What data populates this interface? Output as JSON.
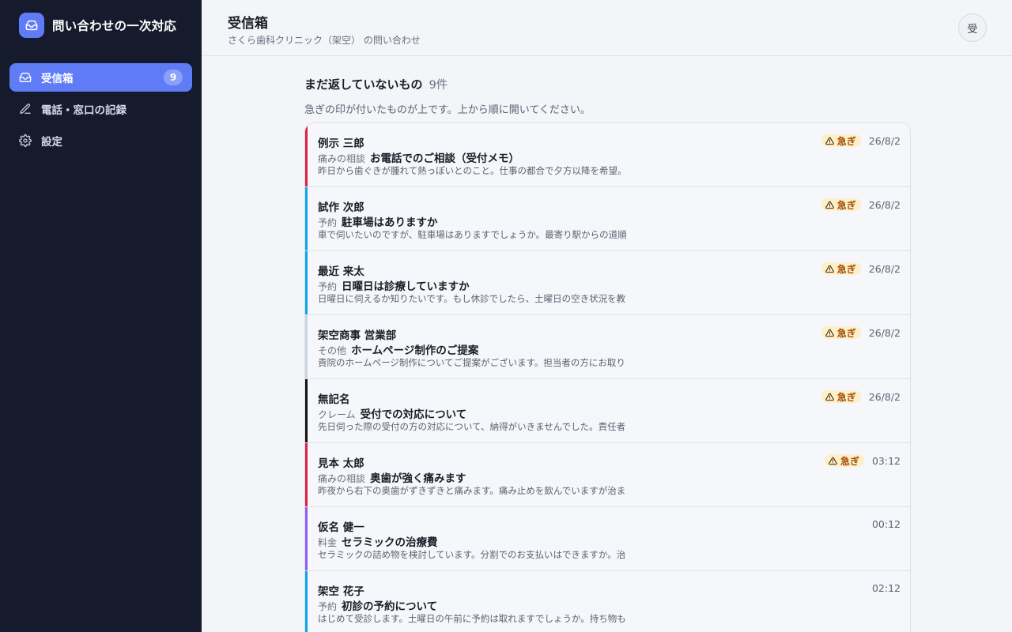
{
  "app": {
    "title": "問い合わせの一次対応"
  },
  "sidebar": {
    "items": [
      {
        "label": "受信箱",
        "badge": "9",
        "icon": "inbox-icon",
        "active": true
      },
      {
        "label": "電話・窓口の記録",
        "icon": "pencil-icon"
      },
      {
        "label": "設定",
        "icon": "gear-icon"
      }
    ]
  },
  "header": {
    "title": "受信箱",
    "subtitle": "さくら歯科クリニック（架空） の問い合わせ",
    "avatar": "受"
  },
  "main": {
    "section_title": "まだ返していないもの",
    "count": "9件",
    "note": "急ぎの印が付いたものが上です。上から順に開いてください。",
    "urgent_label": "急ぎ"
  },
  "colors": {
    "accent": "#5f7cf6",
    "sidebar_bg": "#151a2d",
    "urgent_bg": "#fdefc8",
    "urgent_text": "#a4510b"
  },
  "messages": [
    {
      "name": "例示 三郎",
      "category": "痛みの相談",
      "subject": "お電話でのご相談（受付メモ）",
      "preview": "昨日から歯ぐきが腫れて熱っぽいとのこと。仕事の都合で夕方以降を希望。",
      "time": "26/8/2",
      "urgent": true,
      "color": "#e11d48"
    },
    {
      "name": "試作 次郎",
      "category": "予約",
      "subject": "駐車場はありますか",
      "preview": "車で伺いたいのですが、駐車場はありますでしょうか。最寄り駅からの道順",
      "time": "26/8/2",
      "urgent": true,
      "color": "#0ea5e9"
    },
    {
      "name": "最近 来太",
      "category": "予約",
      "subject": "日曜日は診療していますか",
      "preview": "日曜日に伺えるか知りたいです。もし休診でしたら、土曜日の空き状況を教",
      "time": "26/8/2",
      "urgent": true,
      "color": "#0ea5e9"
    },
    {
      "name": "架空商事 営業部",
      "category": "その他",
      "subject": "ホームページ制作のご提案",
      "preview": "貴院のホームページ制作についてご提案がございます。担当者の方にお取り",
      "time": "26/8/2",
      "urgent": true,
      "color": "#cbd5e1"
    },
    {
      "name": "無記名",
      "category": "クレーム",
      "subject": "受付での対応について",
      "preview": "先日伺った際の受付の方の対応について、納得がいきませんでした。責任者",
      "time": "26/8/2",
      "urgent": true,
      "color": "#111111"
    },
    {
      "name": "見本 太郎",
      "category": "痛みの相談",
      "subject": "奥歯が強く痛みます",
      "preview": "昨夜から右下の奥歯がずきずきと痛みます。痛み止めを飲んでいますが治ま",
      "time": "03:12",
      "urgent": true,
      "color": "#e11d48"
    },
    {
      "name": "仮名 健一",
      "category": "料金",
      "subject": "セラミックの治療費",
      "preview": "セラミックの詰め物を検討しています。分割でのお支払いはできますか。治",
      "time": "00:12",
      "urgent": false,
      "color": "#8b5cf6"
    },
    {
      "name": "架空 花子",
      "category": "予約",
      "subject": "初診の予約について",
      "preview": "はじめて受診します。土曜日の午前に予約は取れますでしょうか。持ち物も",
      "time": "02:12",
      "urgent": false,
      "color": "#0ea5e9"
    }
  ]
}
